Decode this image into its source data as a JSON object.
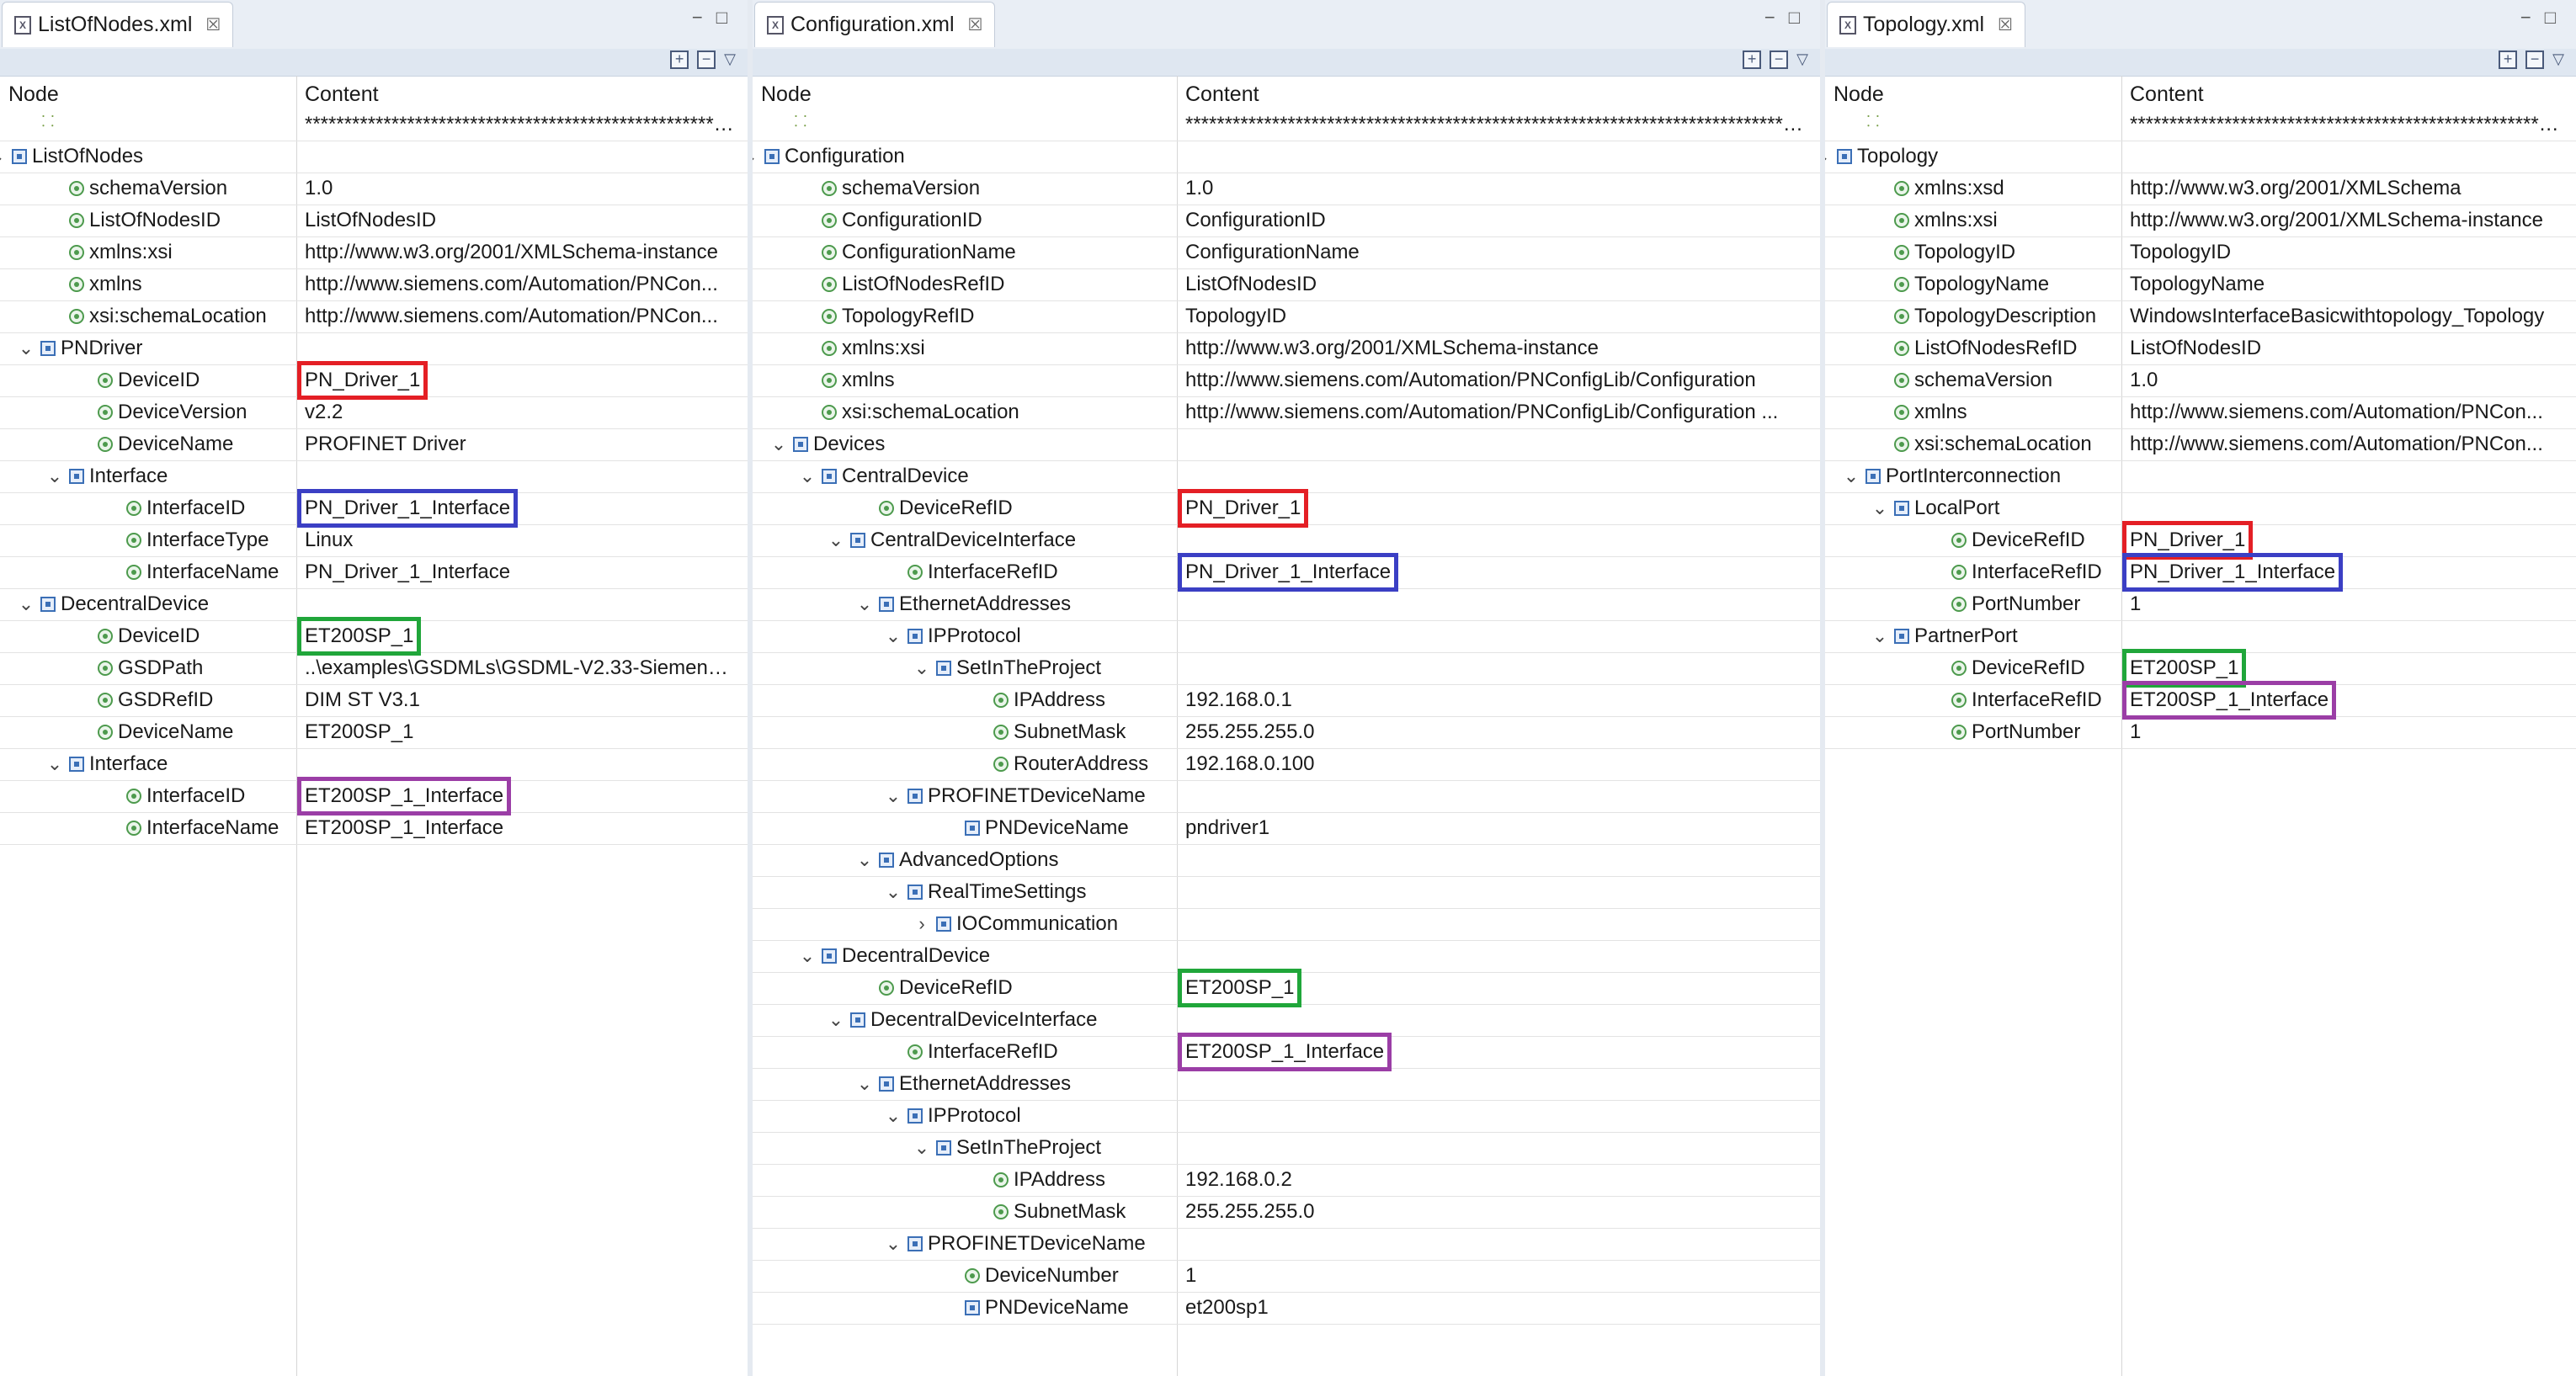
{
  "colors": {
    "highlight_red": "#e41f25",
    "highlight_blue": "#3b3fc4",
    "highlight_green": "#20a63a",
    "highlight_purple": "#9b3ea6"
  },
  "panels": [
    {
      "tab_title": "ListOfNodes.xml",
      "header_node": "Node",
      "header_content": "Content",
      "rows": [
        {
          "node": "",
          "icon": "comment",
          "depth": 1,
          "content": "**********************************************************"
        },
        {
          "node": "ListOfNodes",
          "icon": "element",
          "depth": 0,
          "chev": "v",
          "content": ""
        },
        {
          "node": "schemaVersion",
          "icon": "attr",
          "depth": 2,
          "content": "1.0"
        },
        {
          "node": "ListOfNodesID",
          "icon": "attr",
          "depth": 2,
          "content": "ListOfNodesID"
        },
        {
          "node": "xmlns:xsi",
          "icon": "attr",
          "depth": 2,
          "content": "http://www.w3.org/2001/XMLSchema-instance"
        },
        {
          "node": "xmlns",
          "icon": "attr",
          "depth": 2,
          "content": "http://www.siemens.com/Automation/PNCon..."
        },
        {
          "node": "xsi:schemaLocation",
          "icon": "attr",
          "depth": 2,
          "content": "http://www.siemens.com/Automation/PNCon..."
        },
        {
          "node": "PNDriver",
          "icon": "element",
          "depth": 1,
          "chev": "v",
          "content": ""
        },
        {
          "node": "DeviceID",
          "icon": "attr",
          "depth": 3,
          "content": "PN_Driver_1",
          "hl": "red"
        },
        {
          "node": "DeviceVersion",
          "icon": "attr",
          "depth": 3,
          "content": "v2.2"
        },
        {
          "node": "DeviceName",
          "icon": "attr",
          "depth": 3,
          "content": "PROFINET Driver"
        },
        {
          "node": "Interface",
          "icon": "element",
          "depth": 2,
          "chev": "v",
          "content": ""
        },
        {
          "node": "InterfaceID",
          "icon": "attr",
          "depth": 4,
          "content": "PN_Driver_1_Interface",
          "hl": "blue"
        },
        {
          "node": "InterfaceType",
          "icon": "attr",
          "depth": 4,
          "content": "Linux"
        },
        {
          "node": "InterfaceName",
          "icon": "attr",
          "depth": 4,
          "content": "PN_Driver_1_Interface"
        },
        {
          "node": "DecentralDevice",
          "icon": "element",
          "depth": 1,
          "chev": "v",
          "content": ""
        },
        {
          "node": "DeviceID",
          "icon": "attr",
          "depth": 3,
          "content": "ET200SP_1",
          "hl": "green"
        },
        {
          "node": "GSDPath",
          "icon": "attr",
          "depth": 3,
          "content": "..\\examples\\GSDMLs\\GSDML-V2.33-Siemens-..."
        },
        {
          "node": "GSDRefID",
          "icon": "attr",
          "depth": 3,
          "content": "DIM ST V3.1"
        },
        {
          "node": "DeviceName",
          "icon": "attr",
          "depth": 3,
          "content": "ET200SP_1"
        },
        {
          "node": "Interface",
          "icon": "element",
          "depth": 2,
          "chev": "v",
          "content": ""
        },
        {
          "node": "InterfaceID",
          "icon": "attr",
          "depth": 4,
          "content": "ET200SP_1_Interface",
          "hl": "purple"
        },
        {
          "node": "InterfaceName",
          "icon": "attr",
          "depth": 4,
          "content": "ET200SP_1_Interface"
        }
      ]
    },
    {
      "tab_title": "Configuration.xml",
      "header_node": "Node",
      "header_content": "Content",
      "rows": [
        {
          "node": "",
          "icon": "comment",
          "depth": 1,
          "content": "**********************************************************************************"
        },
        {
          "node": "Configuration",
          "icon": "element",
          "depth": 0,
          "chev": "v",
          "content": ""
        },
        {
          "node": "schemaVersion",
          "icon": "attr",
          "depth": 2,
          "content": "1.0"
        },
        {
          "node": "ConfigurationID",
          "icon": "attr",
          "depth": 2,
          "content": "ConfigurationID"
        },
        {
          "node": "ConfigurationName",
          "icon": "attr",
          "depth": 2,
          "content": "ConfigurationName"
        },
        {
          "node": "ListOfNodesRefID",
          "icon": "attr",
          "depth": 2,
          "content": "ListOfNodesID"
        },
        {
          "node": "TopologyRefID",
          "icon": "attr",
          "depth": 2,
          "content": "TopologyID"
        },
        {
          "node": "xmlns:xsi",
          "icon": "attr",
          "depth": 2,
          "content": "http://www.w3.org/2001/XMLSchema-instance"
        },
        {
          "node": "xmlns",
          "icon": "attr",
          "depth": 2,
          "content": "http://www.siemens.com/Automation/PNConfigLib/Configuration"
        },
        {
          "node": "xsi:schemaLocation",
          "icon": "attr",
          "depth": 2,
          "content": "http://www.siemens.com/Automation/PNConfigLib/Configuration ..."
        },
        {
          "node": "Devices",
          "icon": "element",
          "depth": 1,
          "chev": "v",
          "content": ""
        },
        {
          "node": "CentralDevice",
          "icon": "element",
          "depth": 2,
          "chev": "v",
          "content": ""
        },
        {
          "node": "DeviceRefID",
          "icon": "attr",
          "depth": 4,
          "content": "PN_Driver_1",
          "hl": "red"
        },
        {
          "node": "CentralDeviceInterface",
          "icon": "element",
          "depth": 3,
          "chev": "v",
          "content": ""
        },
        {
          "node": "InterfaceRefID",
          "icon": "attr",
          "depth": 5,
          "content": "PN_Driver_1_Interface",
          "hl": "blue"
        },
        {
          "node": "EthernetAddresses",
          "icon": "element",
          "depth": 4,
          "chev": "v",
          "content": ""
        },
        {
          "node": "IPProtocol",
          "icon": "element",
          "depth": 5,
          "chev": "v",
          "content": ""
        },
        {
          "node": "SetInTheProject",
          "icon": "element",
          "depth": 6,
          "chev": "v",
          "content": ""
        },
        {
          "node": "IPAddress",
          "icon": "attr",
          "depth": 8,
          "content": "192.168.0.1"
        },
        {
          "node": "SubnetMask",
          "icon": "attr",
          "depth": 8,
          "content": "255.255.255.0"
        },
        {
          "node": "RouterAddress",
          "icon": "attr",
          "depth": 8,
          "content": "192.168.0.100"
        },
        {
          "node": "PROFINETDeviceName",
          "icon": "element",
          "depth": 5,
          "chev": "v",
          "content": ""
        },
        {
          "node": "PNDeviceName",
          "icon": "element",
          "depth": 7,
          "content": "pndriver1"
        },
        {
          "node": "AdvancedOptions",
          "icon": "element",
          "depth": 4,
          "chev": "v",
          "content": ""
        },
        {
          "node": "RealTimeSettings",
          "icon": "element",
          "depth": 5,
          "chev": "v",
          "content": ""
        },
        {
          "node": "IOCommunication",
          "icon": "element",
          "depth": 6,
          "chev": ">",
          "content": ""
        },
        {
          "node": "DecentralDevice",
          "icon": "element",
          "depth": 2,
          "chev": "v",
          "content": ""
        },
        {
          "node": "DeviceRefID",
          "icon": "attr",
          "depth": 4,
          "content": "ET200SP_1",
          "hl": "green"
        },
        {
          "node": "DecentralDeviceInterface",
          "icon": "element",
          "depth": 3,
          "chev": "v",
          "content": ""
        },
        {
          "node": "InterfaceRefID",
          "icon": "attr",
          "depth": 5,
          "content": "ET200SP_1_Interface",
          "hl": "purple"
        },
        {
          "node": "EthernetAddresses",
          "icon": "element",
          "depth": 4,
          "chev": "v",
          "content": ""
        },
        {
          "node": "IPProtocol",
          "icon": "element",
          "depth": 5,
          "chev": "v",
          "content": ""
        },
        {
          "node": "SetInTheProject",
          "icon": "element",
          "depth": 6,
          "chev": "v",
          "content": ""
        },
        {
          "node": "IPAddress",
          "icon": "attr",
          "depth": 8,
          "content": "192.168.0.2"
        },
        {
          "node": "SubnetMask",
          "icon": "attr",
          "depth": 8,
          "content": "255.255.255.0"
        },
        {
          "node": "PROFINETDeviceName",
          "icon": "element",
          "depth": 5,
          "chev": "v",
          "content": ""
        },
        {
          "node": "DeviceNumber",
          "icon": "attr",
          "depth": 7,
          "content": "1"
        },
        {
          "node": "PNDeviceName",
          "icon": "element",
          "depth": 7,
          "content": "et200sp1"
        }
      ]
    },
    {
      "tab_title": "Topology.xml",
      "header_node": "Node",
      "header_content": "Content",
      "rows": [
        {
          "node": "",
          "icon": "comment",
          "depth": 1,
          "content": "**********************************************************"
        },
        {
          "node": "Topology",
          "icon": "element",
          "depth": 0,
          "chev": "v",
          "content": ""
        },
        {
          "node": "xmlns:xsd",
          "icon": "attr",
          "depth": 2,
          "content": "http://www.w3.org/2001/XMLSchema"
        },
        {
          "node": "xmlns:xsi",
          "icon": "attr",
          "depth": 2,
          "content": "http://www.w3.org/2001/XMLSchema-instance"
        },
        {
          "node": "TopologyID",
          "icon": "attr",
          "depth": 2,
          "content": "TopologyID"
        },
        {
          "node": "TopologyName",
          "icon": "attr",
          "depth": 2,
          "content": "TopologyName"
        },
        {
          "node": "TopologyDescription",
          "icon": "attr",
          "depth": 2,
          "content": "WindowsInterfaceBasicwithtopology_Topology"
        },
        {
          "node": "ListOfNodesRefID",
          "icon": "attr",
          "depth": 2,
          "content": "ListOfNodesID"
        },
        {
          "node": "schemaVersion",
          "icon": "attr",
          "depth": 2,
          "content": "1.0"
        },
        {
          "node": "xmlns",
          "icon": "attr",
          "depth": 2,
          "content": "http://www.siemens.com/Automation/PNCon..."
        },
        {
          "node": "xsi:schemaLocation",
          "icon": "attr",
          "depth": 2,
          "content": "http://www.siemens.com/Automation/PNCon..."
        },
        {
          "node": "PortInterconnection",
          "icon": "element",
          "depth": 1,
          "chev": "v",
          "content": ""
        },
        {
          "node": "LocalPort",
          "icon": "element",
          "depth": 2,
          "chev": "v",
          "content": ""
        },
        {
          "node": "DeviceRefID",
          "icon": "attr",
          "depth": 4,
          "content": "PN_Driver_1",
          "hl": "red"
        },
        {
          "node": "InterfaceRefID",
          "icon": "attr",
          "depth": 4,
          "content": "PN_Driver_1_Interface",
          "hl": "blue"
        },
        {
          "node": "PortNumber",
          "icon": "attr",
          "depth": 4,
          "content": "1"
        },
        {
          "node": "PartnerPort",
          "icon": "element",
          "depth": 2,
          "chev": "v",
          "content": ""
        },
        {
          "node": "DeviceRefID",
          "icon": "attr",
          "depth": 4,
          "content": "ET200SP_1",
          "hl": "green"
        },
        {
          "node": "InterfaceRefID",
          "icon": "attr",
          "depth": 4,
          "content": "ET200SP_1_Interface",
          "hl": "purple"
        },
        {
          "node": "PortNumber",
          "icon": "attr",
          "depth": 4,
          "content": "1"
        }
      ]
    }
  ]
}
